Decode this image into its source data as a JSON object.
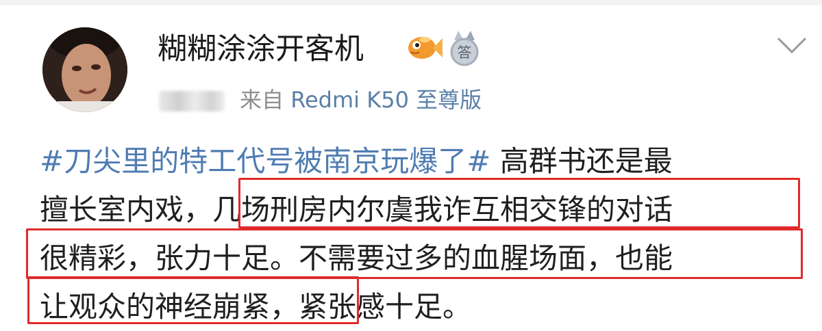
{
  "user": {
    "name": "糊糊涂涂开客机",
    "badges": [
      "fish-icon",
      "answer-medal-icon"
    ],
    "medal_char": "答"
  },
  "meta": {
    "source_prefix": "来自",
    "device": "Redmi K50 至尊版"
  },
  "post": {
    "hashtag": "#刀尖里的特工代号被南京玩爆了#",
    "line1_rest": " 高群书还是最",
    "line2": "擅长室内戏，几场刑房内尔虞我诈互相交锋的对话",
    "line3": "很精彩，张力十足。不需要过多的血腥场面，也能",
    "line4": "让观众的神经崩紧，紧张感十足。"
  },
  "highlights": [
    "几场刑房内尔虞我诈互相交锋的对话",
    "很精彩，张力十足。不需要过多的血腥场面，也能",
    "让观众的神经崩紧，"
  ],
  "colors": {
    "link": "#4f7cb2",
    "meta_gray": "#8d8d8d",
    "highlight_border": "#e02a2a",
    "text": "#1f1f1f"
  },
  "icons": {
    "menu": "chevron-down-icon"
  }
}
